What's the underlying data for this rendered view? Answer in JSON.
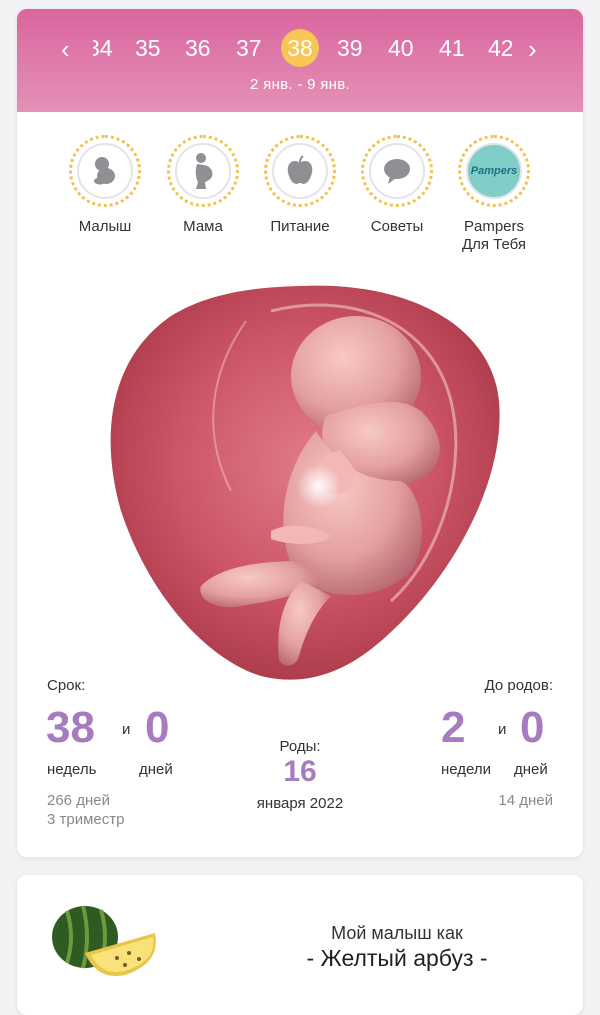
{
  "weeks": {
    "items": [
      "34",
      "35",
      "36",
      "37",
      "38",
      "39",
      "40",
      "41",
      "42"
    ],
    "active": "38",
    "date_range": "2 янв. - 9 янв."
  },
  "categories": [
    {
      "label": "Малыш",
      "icon": "baby-icon"
    },
    {
      "label": "Мама",
      "icon": "pregnant-woman-icon"
    },
    {
      "label": "Питание",
      "icon": "apple-icon"
    },
    {
      "label": "Советы",
      "icon": "speech-bubble-icon"
    },
    {
      "label1": "Pampers",
      "label2": "Для Тебя",
      "icon": "pampers-logo",
      "logo_text": "Pampers"
    }
  ],
  "term": {
    "label": "Срок:",
    "weeks": "38",
    "and": "и",
    "days": "0",
    "weeks_unit": "недель",
    "days_unit": "дней",
    "total_days": "266 дней",
    "trimester": "3 триместр"
  },
  "birth": {
    "label": "Роды:",
    "day": "16",
    "month_year": "января 2022"
  },
  "until_birth": {
    "label": "До родов:",
    "weeks": "2",
    "and": "и",
    "days": "0",
    "weeks_unit": "недели",
    "days_unit": "дней",
    "total_days": "14 дней"
  },
  "fruit": {
    "prefix": "Мой малыш как",
    "name": "- Желтый арбуз -"
  },
  "colors": {
    "header_pink": "#d9659e",
    "active_week": "#f7c655",
    "accent_purple": "#a77bbf"
  }
}
